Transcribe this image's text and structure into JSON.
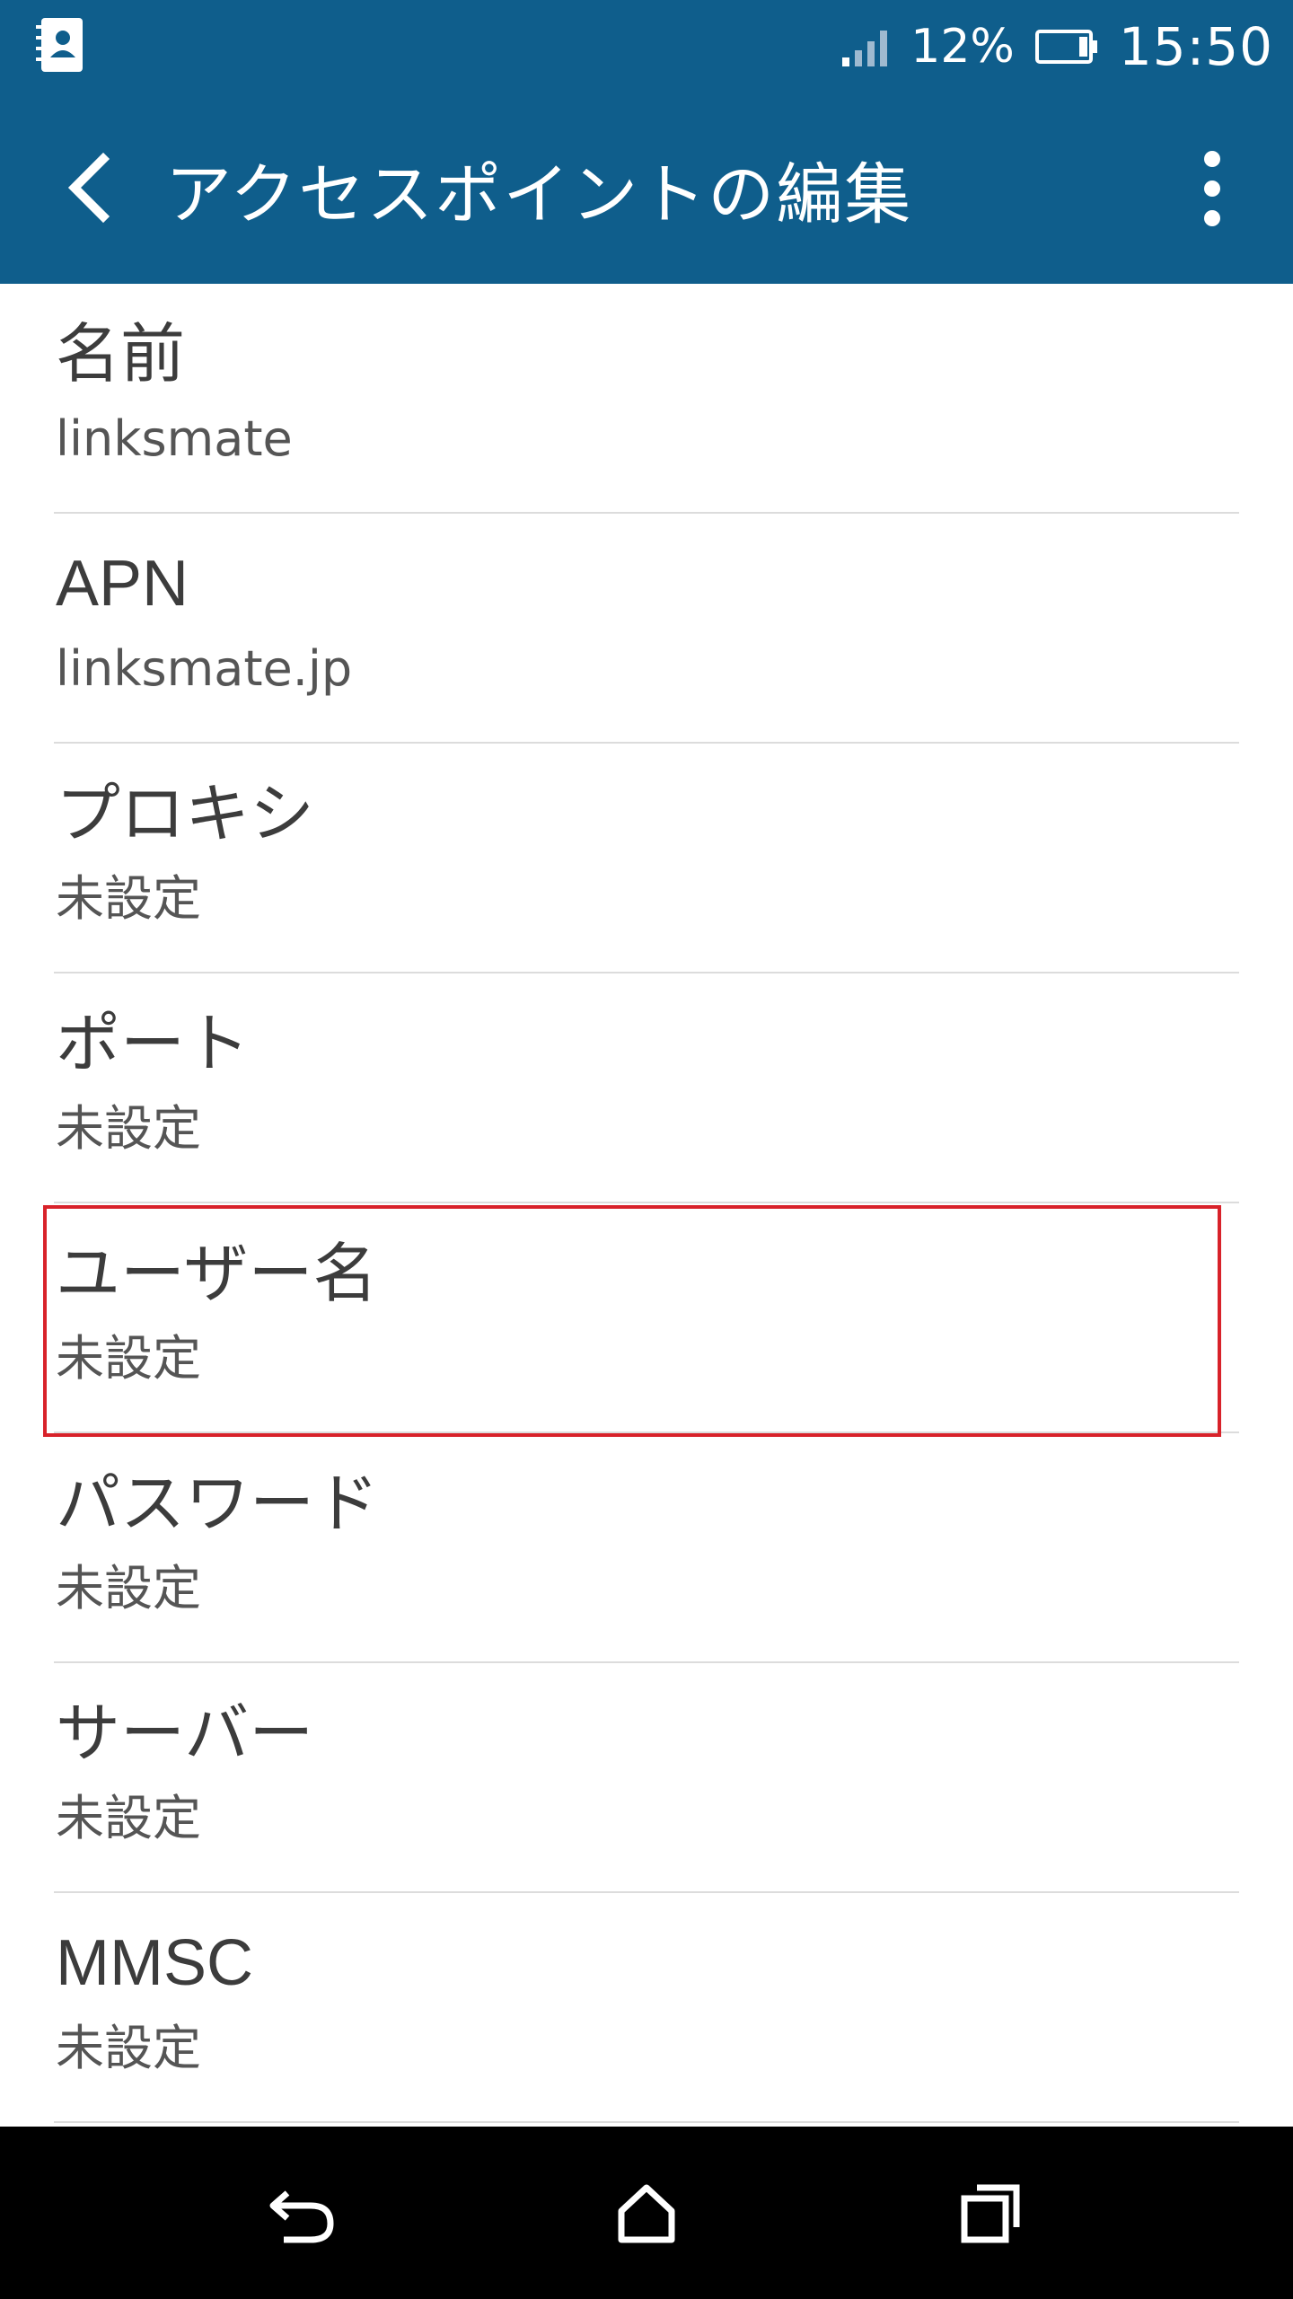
{
  "status_bar": {
    "battery_percent": "12%",
    "time": "15:50",
    "left_icon": "contacts-notification-icon",
    "signal_icon": "signal-icon",
    "battery_icon": "battery-icon"
  },
  "app_bar": {
    "title": "アクセスポイントの編集",
    "back_icon": "chevron-left-icon",
    "menu_icon": "more-vert-icon",
    "color": "#0f5e8c"
  },
  "items": [
    {
      "title": "名前",
      "value": "linksmate"
    },
    {
      "title": "APN",
      "value": "linksmate.jp"
    },
    {
      "title": "プロキシ",
      "value": "未設定"
    },
    {
      "title": "ポート",
      "value": "未設定"
    },
    {
      "title": "ユーザー名",
      "value": "未設定"
    },
    {
      "title": "パスワード",
      "value": "未設定"
    },
    {
      "title": "サーバー",
      "value": "未設定"
    },
    {
      "title": "MMSC",
      "value": "未設定"
    }
  ],
  "highlight_color": "#d8222a",
  "nav_bar": {
    "back_icon": "back-icon",
    "home_icon": "home-icon",
    "recents_icon": "recents-icon"
  }
}
